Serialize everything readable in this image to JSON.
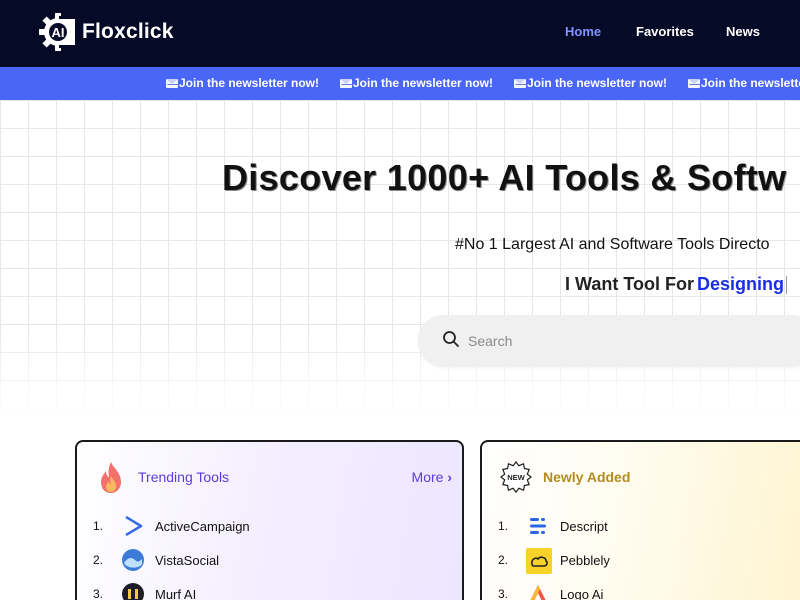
{
  "header": {
    "logo_text": "Floxclick",
    "logo_badge": "AI",
    "nav": [
      {
        "label": "Home",
        "active": true
      },
      {
        "label": "Favorites",
        "active": false
      },
      {
        "label": "News",
        "active": false
      }
    ]
  },
  "ticker": {
    "items": [
      "Join the newsletter now!",
      "Join the newsletter now!",
      "Join the newsletter now!",
      "Join the newsletter now!"
    ],
    "icon": "envelope-icon"
  },
  "hero": {
    "title": "Discover 1000+ AI Tools & Softw",
    "subtitle": "#No 1 Largest AI and Software Tools Directo",
    "want_prefix": "I Want Tool For",
    "want_keyword": "Designing"
  },
  "search": {
    "placeholder": "Search"
  },
  "trending": {
    "title": "Trending Tools",
    "more_label": "More",
    "items": [
      {
        "num": "1.",
        "name": "ActiveCampaign",
        "icon": "activecampaign-icon"
      },
      {
        "num": "2.",
        "name": "VistaSocial",
        "icon": "vistasocial-icon"
      },
      {
        "num": "3.",
        "name": "Murf AI",
        "icon": "murf-icon"
      }
    ]
  },
  "newly": {
    "title": "Newly Added",
    "badge": "NEW",
    "items": [
      {
        "num": "1.",
        "name": "Descript",
        "icon": "descript-icon"
      },
      {
        "num": "2.",
        "name": "Pebblely",
        "icon": "pebblely-icon"
      },
      {
        "num": "3.",
        "name": "Logo Ai",
        "icon": "logoai-icon"
      }
    ]
  },
  "colors": {
    "header_bg": "#050b26",
    "ticker_bg": "#4a66f6",
    "nav_active": "#7f93ff",
    "keyword": "#1a2ee8",
    "trending_accent": "#5a3de0",
    "newly_accent": "#b48c1e"
  }
}
